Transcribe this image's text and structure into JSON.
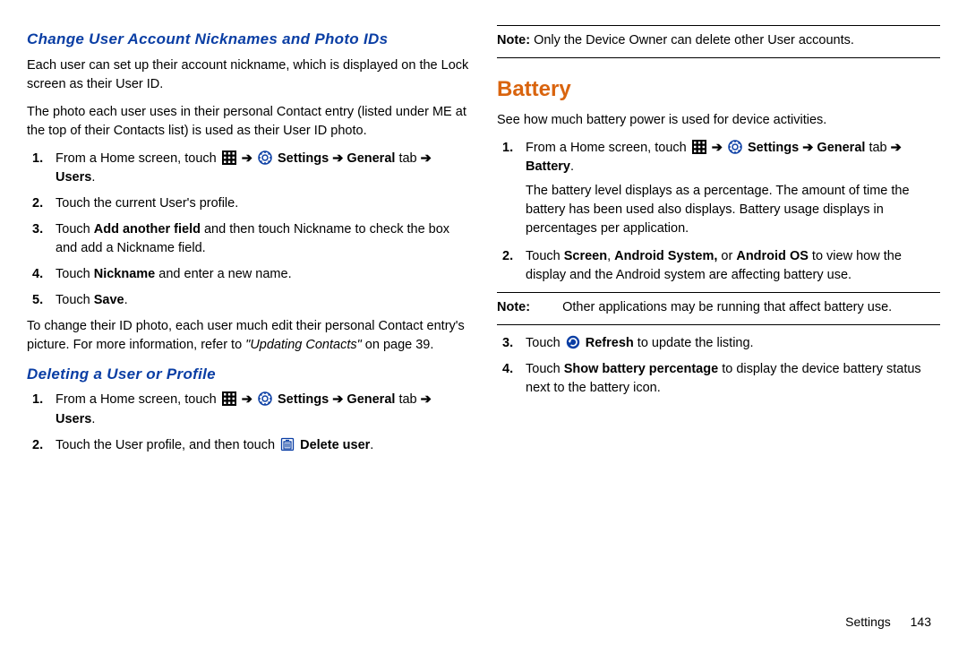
{
  "left": {
    "heading_change": "Change User Account Nicknames and Photo IDs",
    "p1": "Each user can set up their account nickname, which is displayed on the Lock screen as their User ID.",
    "p2": "The photo each user uses in their personal Contact entry (listed under ME at the top of their Contacts list) is used as their User ID photo.",
    "steps_change": {
      "s1_a": "From a Home screen, touch ",
      "s1_b_settings": "Settings",
      "s1_c_general": "General",
      "s1_d_tab": " tab ",
      "s1_e_users": "Users",
      "s2": "Touch the current User's profile.",
      "s3_a": "Touch ",
      "s3_b": "Add another field",
      "s3_c": " and then touch Nickname to check the box and add a Nickname field.",
      "s4_a": "Touch ",
      "s4_b": "Nickname",
      "s4_c": " and enter a new name.",
      "s5_a": "Touch ",
      "s5_b": "Save",
      "s5_c": "."
    },
    "p3_a": "To change their ID photo, each user much edit their personal Contact entry's picture. For more information, refer to ",
    "p3_b": "\"Updating Contacts\"",
    "p3_c": " on page 39.",
    "heading_delete": "Deleting a User or Profile",
    "steps_delete": {
      "s1_a": "From a Home screen, touch ",
      "s1_b_settings": "Settings",
      "s1_c_general": "General",
      "s1_d_tab": " tab ",
      "s1_e_users": "Users",
      "s2_a": "Touch the User profile, and then touch ",
      "s2_b": "Delete user",
      "s2_c": "."
    }
  },
  "right": {
    "note_top_label": "Note:",
    "note_top": " Only the Device Owner can delete other User accounts.",
    "heading_battery": "Battery",
    "p1": "See how much battery power is used for device activities.",
    "steps_battery": {
      "s1_a": "From a Home screen, touch ",
      "s1_b_settings": "Settings",
      "s1_c_general": "General",
      "s1_d_tab": " tab ",
      "s1_e_battery": "Battery",
      "s1_follow": "The battery level displays as a percentage. The amount of time the battery has been used also displays. Battery usage displays in percentages per application.",
      "s2_a": "Touch ",
      "s2_b": "Screen",
      "s2_c": ", ",
      "s2_d": "Android System,",
      "s2_e": " or ",
      "s2_f": "Android OS",
      "s2_g": " to view how the display and the Android system are affecting battery use."
    },
    "note_mid_label": "Note:",
    "note_mid": " Other applications may be running that affect battery use.",
    "steps_battery_b": {
      "s3_a": "Touch ",
      "s3_b": "Refresh",
      "s3_c": " to update the listing.",
      "s4_a": "Touch ",
      "s4_b": "Show battery percentage",
      "s4_c": " to display the device battery status next to the battery icon."
    }
  },
  "footer": {
    "section": "Settings",
    "page": "143"
  },
  "glyphs": {
    "arrow": "➔"
  }
}
